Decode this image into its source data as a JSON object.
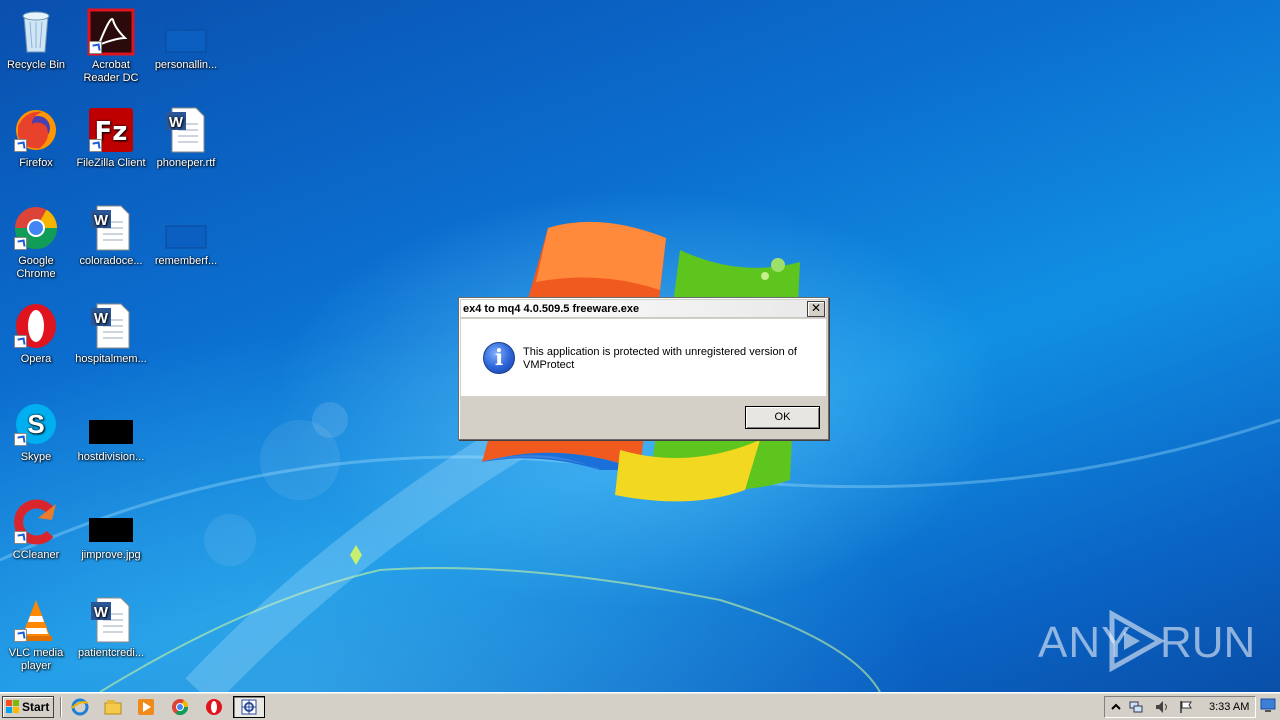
{
  "desktop": {
    "icons": [
      {
        "label": "Recycle Bin",
        "icon": "recycle-bin-icon"
      },
      {
        "label": "Acrobat Reader DC",
        "icon": "acrobat-icon"
      },
      {
        "label": "personallin...",
        "icon": "file-icon"
      },
      {
        "label": "Firefox",
        "icon": "firefox-icon"
      },
      {
        "label": "FileZilla Client",
        "icon": "filezilla-icon"
      },
      {
        "label": "phoneper.rtf",
        "icon": "word-doc-icon"
      },
      {
        "label": "Google Chrome",
        "icon": "chrome-icon"
      },
      {
        "label": "coloradoce...",
        "icon": "word-doc-icon"
      },
      {
        "label": "rememberf...",
        "icon": "file-icon"
      },
      {
        "label": "Opera",
        "icon": "opera-icon"
      },
      {
        "label": "hospitalmem...",
        "icon": "word-doc-icon"
      },
      {
        "label": "Skype",
        "icon": "skype-icon"
      },
      {
        "label": "hostdivision...",
        "icon": "image-file-icon"
      },
      {
        "label": "CCleaner",
        "icon": "ccleaner-icon"
      },
      {
        "label": "jimprove.jpg",
        "icon": "image-file-icon"
      },
      {
        "label": "VLC media player",
        "icon": "vlc-icon"
      },
      {
        "label": "patientcredi...",
        "icon": "word-doc-icon"
      }
    ]
  },
  "dialog": {
    "title": "ex4 to mq4 4.0.509.5 freeware.exe",
    "close_label": "✕",
    "message": "This application is protected with unregistered version of VMProtect",
    "ok_label": "OK",
    "icon": "info-icon"
  },
  "watermark": {
    "text_left": "ANY",
    "text_right": "RUN"
  },
  "taskbar": {
    "start_label": "Start",
    "quick_launch": [
      "ie-icon",
      "explorer-icon",
      "media-player-icon",
      "chrome-icon",
      "opera-icon"
    ],
    "active_task_icon": "application-icon",
    "tray_icons": [
      "show-hidden-icon",
      "network-icon",
      "volume-icon",
      "action-center-flag-icon"
    ],
    "clock": "3:33 AM"
  },
  "colors": {
    "wallpaper": "#0b6fd0",
    "taskbar": "#d4d0c8",
    "dialog_button_face": "#d4d0c8"
  }
}
